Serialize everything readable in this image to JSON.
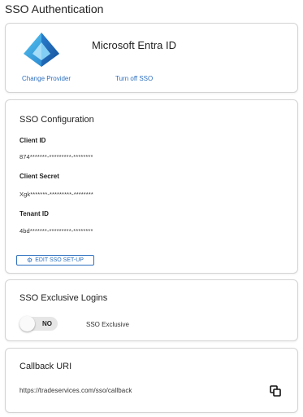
{
  "page": {
    "title": "SSO Authentication"
  },
  "provider": {
    "name": "Microsoft Entra ID",
    "logo_icon": "microsoft-entra-logo",
    "change_label": "Change Provider",
    "turn_off_label": "Turn off SSO"
  },
  "config": {
    "title": "SSO Configuration",
    "fields": [
      {
        "label": "Client ID",
        "value": "874*******-*********-********"
      },
      {
        "label": "Client Secret",
        "value": "Xgk*******-*********-********"
      },
      {
        "label": "Tenant ID",
        "value": "4bd*******-*********-********"
      }
    ],
    "edit_label": "EDIT SSO SET-UP",
    "edit_icon": "gear-icon"
  },
  "exclusive": {
    "title": "SSO Exclusive Logins",
    "toggle_state": "NO",
    "toggle_label": "SSO Exclusive"
  },
  "callback": {
    "title": "Callback URI",
    "uri": "https://tradeservices.com/sso/callback",
    "copy_icon": "copy-icon"
  },
  "colors": {
    "link": "#2c6fbe",
    "border": "#d4d4d4",
    "toggle_track": "#e6e6e6",
    "logo_dark": "#1b5fa8",
    "logo_light": "#49b6ea"
  }
}
